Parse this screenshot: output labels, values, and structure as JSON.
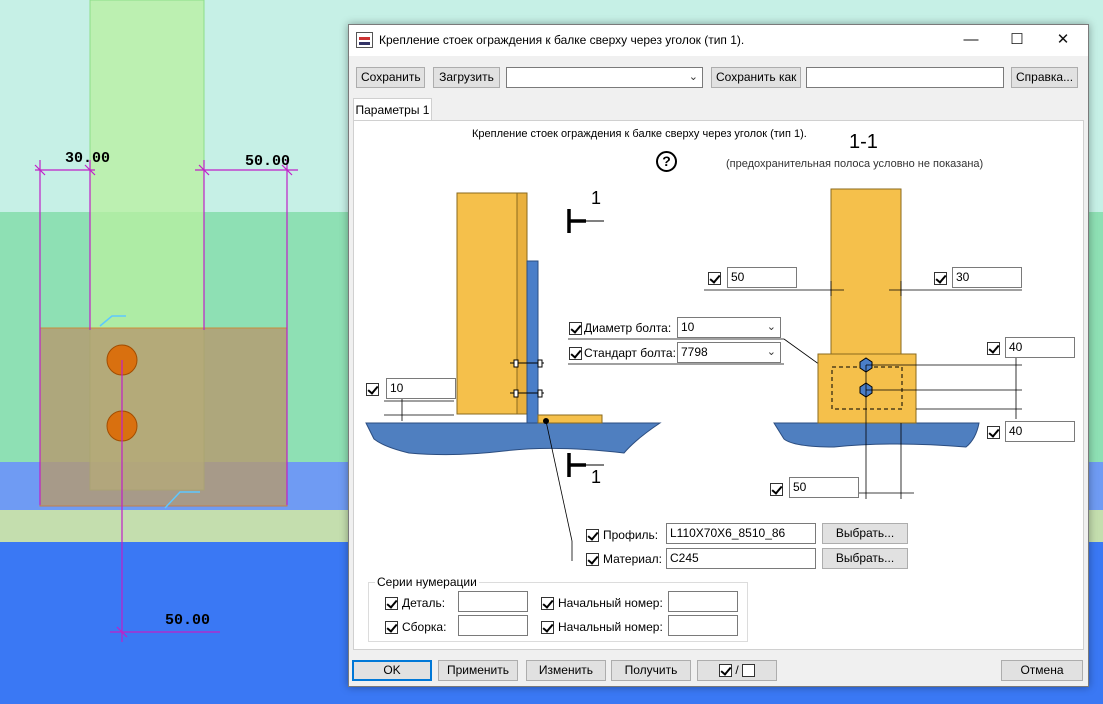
{
  "viewport": {
    "dimensions": [
      "30.00",
      "50.00",
      "50.00"
    ]
  },
  "dialog": {
    "title": "Крепление стоек ограждения к балке сверху через уголок (тип 1).",
    "toolbar": {
      "save_label": "Сохранить",
      "load_label": "Загрузить",
      "preset_value": "",
      "save_as_label": "Сохранить как",
      "save_as_value": "",
      "help_label": "Справка..."
    },
    "tab_label": "Параметры 1",
    "panel": {
      "heading": "Крепление стоек ограждения к балке сверху через уголок (тип 1).",
      "help_glyph": "?",
      "section_label": "1-1",
      "section_note": "(предохранительная полоса условно не показана)",
      "cut_mark_top": "1",
      "cut_mark_bottom": "1",
      "gap_value": "10",
      "bolt_diameter_label": "Диаметр болта:",
      "bolt_diameter_value": "10",
      "bolt_standard_label": "Стандарт болта:",
      "bolt_standard_value": "7798",
      "left_offset_value": "50",
      "right_offset_value": "30",
      "top_edge_value": "40",
      "bolt_spacing_value": "40",
      "bottom_offset_value": "50",
      "profile_label": "Профиль:",
      "profile_value": "L110X70X6_8510_86",
      "profile_select_label": "Выбрать...",
      "material_label": "Материал:",
      "material_value": "C245",
      "material_select_label": "Выбрать...",
      "numbering": {
        "title": "Серии нумерации",
        "part_label": "Деталь:",
        "part_value": "",
        "part_start_label": "Начальный номер:",
        "part_start_value": "",
        "assembly_label": "Сборка:",
        "assembly_value": "",
        "assembly_start_label": "Начальный номер:",
        "assembly_start_value": ""
      }
    },
    "footer": {
      "ok_label": "OK",
      "apply_label": "Применить",
      "modify_label": "Изменить",
      "get_label": "Получить",
      "toggle_label": "/",
      "cancel_label": "Отмена"
    }
  }
}
